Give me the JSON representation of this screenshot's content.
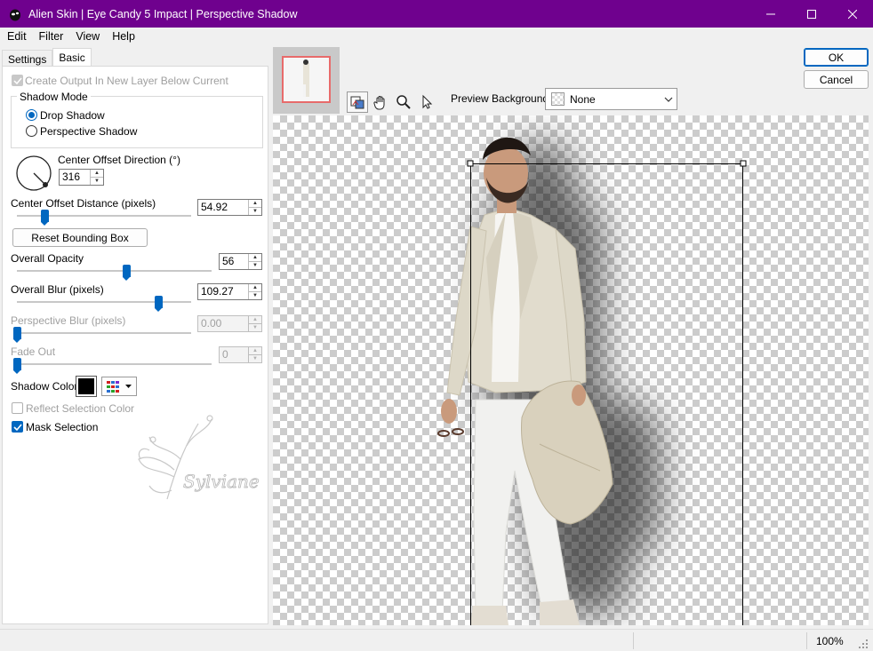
{
  "window": {
    "title": "Alien Skin | Eye Candy 5 Impact | Perspective Shadow",
    "titlebar_color": "#6f018e"
  },
  "menu": [
    "Edit",
    "Filter",
    "View",
    "Help"
  ],
  "tabs": [
    {
      "label": "Settings",
      "active": false
    },
    {
      "label": "Basic",
      "active": true
    }
  ],
  "controls": {
    "create_output_label": "Create Output In New Layer Below Current",
    "shadow_mode": {
      "legend": "Shadow Mode",
      "options": [
        "Drop Shadow",
        "Perspective Shadow"
      ],
      "selected": "Drop Shadow"
    },
    "center_offset_direction": {
      "label": "Center Offset Direction (°)",
      "value": "316"
    },
    "center_offset_distance": {
      "label": "Center Offset Distance (pixels)",
      "value": "54.92",
      "slider_level": 0.16
    },
    "reset_bounding_box_label": "Reset Bounding Box",
    "overall_opacity": {
      "label": "Overall Opacity",
      "value": "56",
      "slider_level": 0.56
    },
    "overall_blur": {
      "label": "Overall Blur (pixels)",
      "value": "109.27",
      "slider_level": 0.81
    },
    "perspective_blur": {
      "label": "Perspective Blur (pixels)",
      "value": "0.00",
      "slider_level": 0
    },
    "fade_out": {
      "label": "Fade Out",
      "value": "0",
      "slider_level": 0
    },
    "shadow_color": {
      "label": "Shadow Color",
      "color": "#000000"
    },
    "reflect_selection_label": "Reflect Selection Color",
    "mask_selection_label": "Mask Selection",
    "watermark_text": "Sylviane"
  },
  "buttons": {
    "ok": "OK",
    "cancel": "Cancel"
  },
  "preview": {
    "background_label": "Preview Background:",
    "background_value": "None"
  },
  "status": {
    "zoom": "100%"
  }
}
